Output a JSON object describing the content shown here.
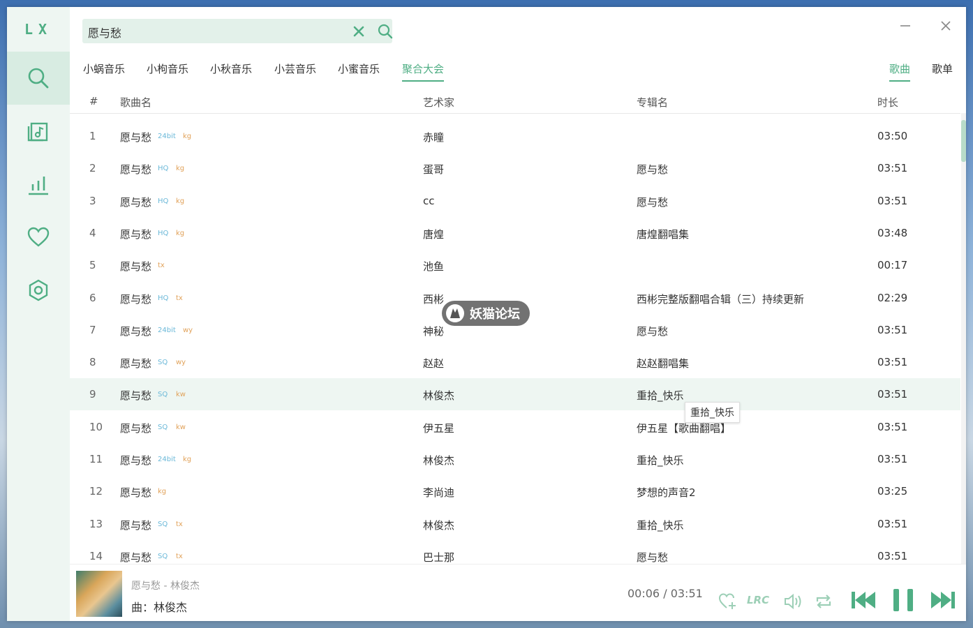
{
  "app": {
    "logo": "LX"
  },
  "search": {
    "value": "愿与愁",
    "placeholder": ""
  },
  "sources": [
    "小蜗音乐",
    "小枸音乐",
    "小秋音乐",
    "小芸音乐",
    "小蜜音乐",
    "聚合大会"
  ],
  "active_source": "聚合大会",
  "view_tabs": [
    "歌曲",
    "歌单"
  ],
  "active_view": "歌曲",
  "columns": {
    "index": "#",
    "name": "歌曲名",
    "artist": "艺术家",
    "album": "专辑名",
    "duration": "时长"
  },
  "rows": [
    {
      "n": "1",
      "name": "愿与愁",
      "quality": "24bit",
      "source": "kg",
      "artist": "赤瞳",
      "album": "",
      "duration": "03:50"
    },
    {
      "n": "2",
      "name": "愿与愁",
      "quality": "HQ",
      "source": "kg",
      "artist": "蛋哥",
      "album": "愿与愁",
      "duration": "03:51"
    },
    {
      "n": "3",
      "name": "愿与愁",
      "quality": "HQ",
      "source": "kg",
      "artist": "cc",
      "album": "愿与愁",
      "duration": "03:51"
    },
    {
      "n": "4",
      "name": "愿与愁",
      "quality": "HQ",
      "source": "kg",
      "artist": "唐煌",
      "album": "唐煌翻唱集",
      "duration": "03:48"
    },
    {
      "n": "5",
      "name": "愿与愁",
      "quality": "",
      "source": "tx",
      "artist": "池鱼",
      "album": "",
      "duration": "00:17"
    },
    {
      "n": "6",
      "name": "愿与愁",
      "quality": "HQ",
      "source": "tx",
      "artist": "西彬",
      "album": "西彬完整版翻唱合辑（三）持续更新",
      "duration": "02:29"
    },
    {
      "n": "7",
      "name": "愿与愁",
      "quality": "24bit",
      "source": "wy",
      "artist": "神秘",
      "album": "愿与愁",
      "duration": "03:51"
    },
    {
      "n": "8",
      "name": "愿与愁",
      "quality": "SQ",
      "source": "wy",
      "artist": "赵赵",
      "album": "赵赵翻唱集",
      "duration": "03:51"
    },
    {
      "n": "9",
      "name": "愿与愁",
      "quality": "SQ",
      "source": "kw",
      "artist": "林俊杰",
      "album": "重拾_快乐",
      "duration": "03:51"
    },
    {
      "n": "10",
      "name": "愿与愁",
      "quality": "SQ",
      "source": "kw",
      "artist": "伊五星",
      "album": "伊五星【歌曲翻唱】",
      "duration": "03:51"
    },
    {
      "n": "11",
      "name": "愿与愁",
      "quality": "24bit",
      "source": "kg",
      "artist": "林俊杰",
      "album": "重拾_快乐",
      "duration": "03:51"
    },
    {
      "n": "12",
      "name": "愿与愁",
      "quality": "",
      "source": "kg",
      "artist": "李尚迪",
      "album": "梦想的声音2",
      "duration": "03:25"
    },
    {
      "n": "13",
      "name": "愿与愁",
      "quality": "SQ",
      "source": "tx",
      "artist": "林俊杰",
      "album": "重拾_快乐",
      "duration": "03:51"
    },
    {
      "n": "14",
      "name": "愿与愁",
      "quality": "SQ",
      "source": "tx",
      "artist": "巴士那",
      "album": "愿与愁",
      "duration": "03:51"
    }
  ],
  "highlighted_row": 9,
  "tooltip": "重拾_快乐",
  "watermark": "妖猫论坛",
  "player": {
    "title": "愿与愁 - 林俊杰",
    "lyric": "曲：林俊杰",
    "current_time": "00:06",
    "separator": "/",
    "total_time": "03:51",
    "lrc_label": "LRC"
  },
  "colors": {
    "accent": "#4fae84",
    "accent_light": "#eef6f2",
    "quality_badge": "#6ab8d8",
    "source_badge": "#e1a25a"
  },
  "icons": [
    "search-icon",
    "music-list-icon",
    "chart-icon",
    "heart-icon",
    "settings-icon",
    "clear-icon",
    "minimize-icon",
    "close-icon",
    "favorite-add-icon",
    "lyric-icon",
    "volume-icon",
    "repeat-icon",
    "prev-icon",
    "pause-icon",
    "next-icon"
  ]
}
